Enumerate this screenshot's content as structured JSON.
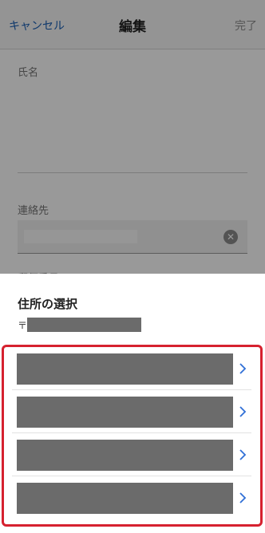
{
  "nav": {
    "cancel_label": "キャンセル",
    "title": "編集",
    "done_label": "完了"
  },
  "form": {
    "name_label": "氏名",
    "contact_label": "連絡先",
    "phone_label": "郵便番号"
  },
  "sheet": {
    "title": "住所の選択",
    "postal_mark": "〒",
    "address_count": 4
  },
  "icons": {
    "clear": "clear-circle-icon",
    "row_arrow": "chevron-right-icon"
  },
  "colors": {
    "accent_blue": "#1a5fb4",
    "highlight_red": "#d6212f",
    "chevron_blue": "#2f6fd6"
  }
}
